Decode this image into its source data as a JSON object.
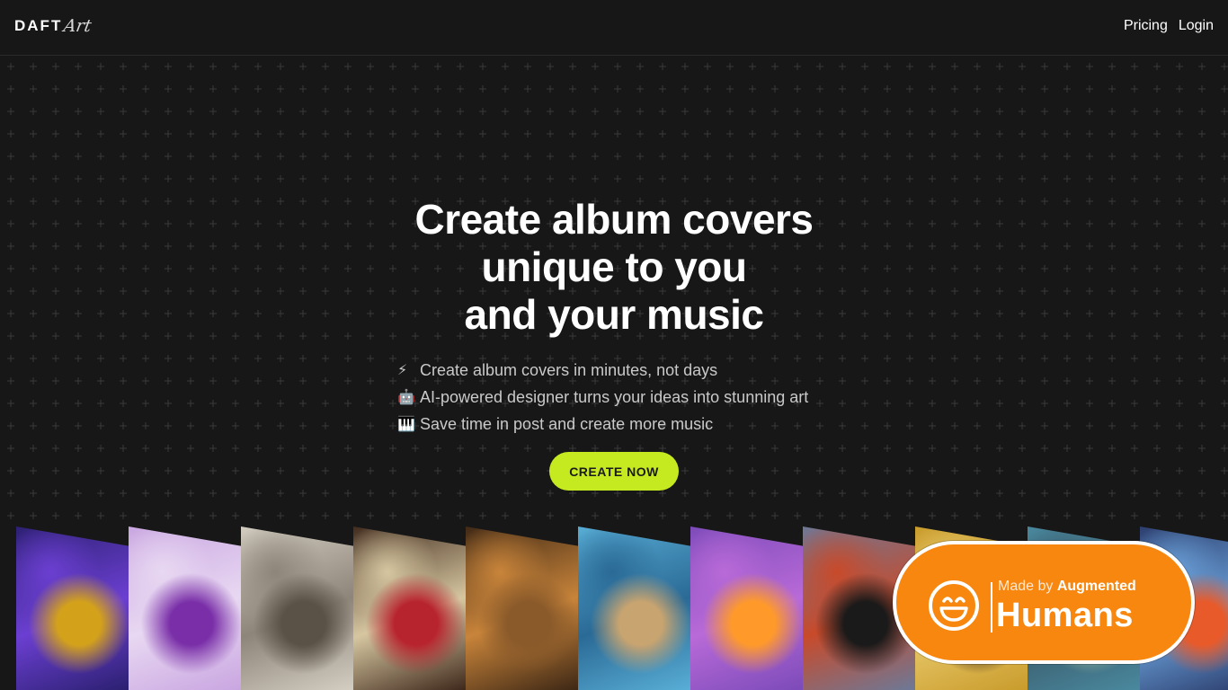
{
  "header": {
    "logo_primary": "DAFT",
    "logo_secondary": "Art",
    "nav": {
      "pricing": "Pricing",
      "login": "Login"
    }
  },
  "hero": {
    "title_lines": [
      "Create album covers",
      "unique to you",
      "and your music"
    ],
    "features": [
      {
        "icon": "⚡",
        "icon_name": "lightning-icon",
        "text": "Create album covers in minutes, not days"
      },
      {
        "icon": "🤖",
        "icon_name": "robot-icon",
        "text": "AI-powered designer turns your ideas into stunning art"
      },
      {
        "icon": "🎹",
        "icon_name": "piano-icon",
        "text": "Save time in post and create more music"
      }
    ],
    "cta_label": "CREATE NOW"
  },
  "covers": [
    {
      "name": "cover-gold-skull",
      "colors": [
        "#2a1f6e",
        "#d4a21a",
        "#6b3fd1"
      ]
    },
    {
      "name": "cover-purple-flowers",
      "colors": [
        "#c8a4e0",
        "#7a2fa8",
        "#e8d8f2"
      ]
    },
    {
      "name": "cover-ink-sketch",
      "colors": [
        "#d6d0c4",
        "#5a5246",
        "#8e857a"
      ]
    },
    {
      "name": "cover-roses-skull",
      "colors": [
        "#3a2418",
        "#b8242e",
        "#d6c6a0"
      ]
    },
    {
      "name": "cover-tree-tunnel",
      "colors": [
        "#3a2514",
        "#8a5a2a",
        "#c8843a"
      ]
    },
    {
      "name": "cover-dolphins",
      "colors": [
        "#5ab0d8",
        "#c8a470",
        "#2a6a96"
      ]
    },
    {
      "name": "cover-neon-building",
      "colors": [
        "#7a4ab8",
        "#ff9a2a",
        "#b86ad8"
      ]
    },
    {
      "name": "cover-crow",
      "colors": [
        "#6a7a9a",
        "#1a1a1a",
        "#c84a2a"
      ]
    },
    {
      "name": "cover-golden-frame",
      "colors": [
        "#c89a2a",
        "#3a2a1a",
        "#e8c86a"
      ]
    },
    {
      "name": "cover-landscape",
      "colors": [
        "#4a8aa0",
        "#9ab8a0",
        "#3a5a6a"
      ]
    },
    {
      "name": "cover-lights",
      "colors": [
        "#2a3a6a",
        "#e85a2a",
        "#6aa0d8"
      ]
    }
  ],
  "badge": {
    "made_by": "Made by",
    "brand": "Augmented",
    "big": "Humans",
    "color": "#f7870f"
  },
  "colors": {
    "accent": "#c6ea20",
    "background": "#171717"
  }
}
